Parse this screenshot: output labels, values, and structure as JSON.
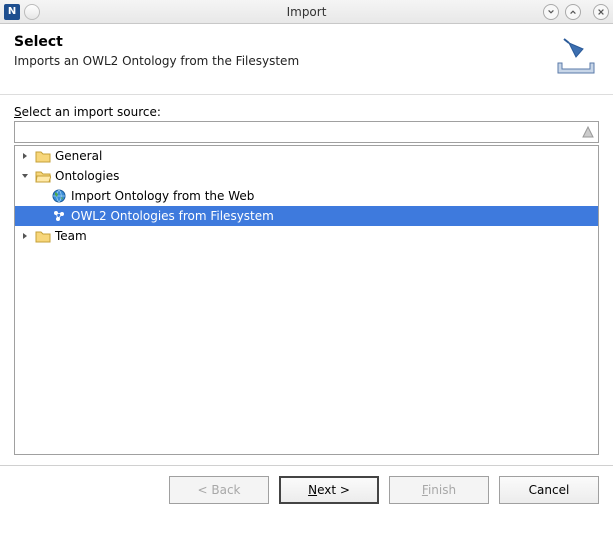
{
  "window": {
    "title": "Import"
  },
  "header": {
    "heading": "Select",
    "subheading": "Imports an OWL2 Ontology from the Filesystem"
  },
  "source": {
    "label_pre": "S",
    "label_post": "elect an import source:",
    "filter_value": ""
  },
  "tree": {
    "items": [
      {
        "label": "General",
        "type": "folder",
        "expanded": false,
        "depth": 0
      },
      {
        "label": "Ontologies",
        "type": "folder",
        "expanded": true,
        "depth": 0
      },
      {
        "label": "Import Ontology from the Web",
        "type": "web",
        "depth": 1
      },
      {
        "label": "OWL2 Ontologies from Filesystem",
        "type": "file",
        "depth": 1,
        "selected": true
      },
      {
        "label": "Team",
        "type": "folder",
        "expanded": false,
        "depth": 0
      }
    ]
  },
  "buttons": {
    "back": "< Back",
    "next_pre": "N",
    "next_post": "ext >",
    "finish_pre": "F",
    "finish_post": "inish",
    "cancel": "Cancel"
  }
}
